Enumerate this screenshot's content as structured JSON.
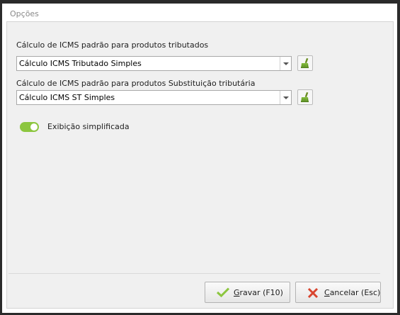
{
  "window": {
    "title": "Opções"
  },
  "fields": [
    {
      "label": "Cálculo de ICMS padrão para produtos tributados",
      "value": "Cálculo ICMS Tributado Simples"
    },
    {
      "label": "Cálculo de ICMS padrão para produtos Substituição tributária",
      "value": "Cálculo ICMS ST Simples"
    }
  ],
  "toggle": {
    "label": "Exibição simplificada",
    "on": true
  },
  "buttons": {
    "save": {
      "label": "Gravar (F10)",
      "mnemonic": "G",
      "rest": "ravar (F10)"
    },
    "cancel": {
      "label": "Cancelar (Esc)",
      "mnemonic": "C",
      "rest": "ancelar (Esc)"
    }
  },
  "colors": {
    "accent_green": "#8cc63f",
    "cancel_red": "#d9452f",
    "panel_bg": "#f0f0f0"
  },
  "icons": [
    "broom-icon",
    "checkmark-icon",
    "x-icon",
    "dropdown-arrow-icon"
  ]
}
